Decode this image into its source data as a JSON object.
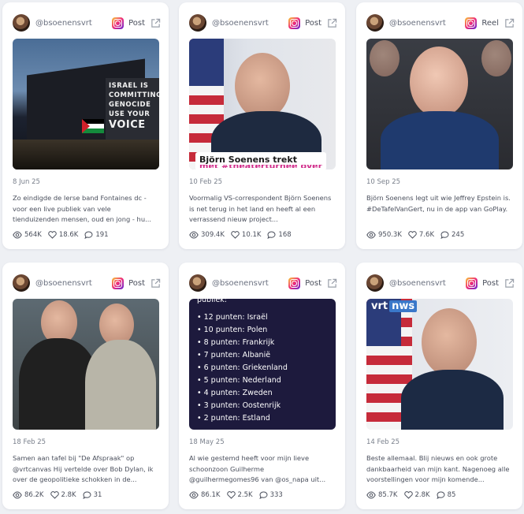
{
  "cards": [
    {
      "handle": "@bsoenensvrt",
      "type": "Post",
      "date": "8 Jun 25",
      "text": "Zo eindigde de Ierse band Fontaines dc - voor een live publiek van vele tienduizenden mensen, oud en jong - hu...",
      "views": "564K",
      "likes": "18.6K",
      "comments": "191",
      "overlay": [
        "ISRAEL IS",
        "COMMITTING",
        "GENOCIDE",
        "USE YOUR",
        "VOICE"
      ]
    },
    {
      "handle": "@bsoenensvrt",
      "type": "Post",
      "date": "10 Feb 25",
      "text": "Voormalig VS-correspondent Björn Soenens is net terug in het land en heeft al een verrassend nieuw project...",
      "views": "309.4K",
      "likes": "10.1K",
      "comments": "168",
      "overlay": [
        "Björn Soenens trekt",
        "met #theaterturnee over"
      ]
    },
    {
      "handle": "@bsoenensvrt",
      "type": "Reel",
      "date": "10 Sep 25",
      "text": "Björn Soenens legt uit wie Jeffrey Epstein is. #DeTafelVanGert, nu in de app van GoPlay.",
      "views": "950.3K",
      "likes": "7.6K",
      "comments": "245"
    },
    {
      "handle": "@bsoenensvrt",
      "type": "Post",
      "date": "18 Feb 25",
      "text": "Samen aan tafel bij \"De Afspraak\" op @vrtcanvas Hij vertelde over Bob Dylan, ik over de geopolitieke schokken in de...",
      "views": "86.2K",
      "likes": "2.8K",
      "comments": "31"
    },
    {
      "handle": "@bsoenensvrt",
      "type": "Post",
      "date": "18 May 25",
      "text": "Al wie gestemd heeft voor mijn lieve schoonzoon Guilherme @guilhermegomes96 van @os_napa uit...",
      "views": "86.1K",
      "likes": "2.5K",
      "comments": "333",
      "overlay": [
        "publiek:",
        "• 12 punten: Israël",
        "• 10 punten: Polen",
        "• 8 punten: Frankrijk",
        "• 7 punten: Albanië",
        "• 6 punten: Griekenland",
        "• 5 punten: Nederland",
        "• 4 punten: Zweden",
        "• 3 punten: Oostenrijk",
        "• 2 punten: Estland"
      ]
    },
    {
      "handle": "@bsoenensvrt",
      "type": "Post",
      "date": "14 Feb 25",
      "text": "Beste allemaal. Blij nieuws en ook grote dankbaarheid van mijn kant. Nagenoeg alle voorstellingen voor mijn komende...",
      "views": "85.7K",
      "likes": "2.8K",
      "comments": "85",
      "overlay": [
        "vrt",
        "nws"
      ]
    }
  ]
}
